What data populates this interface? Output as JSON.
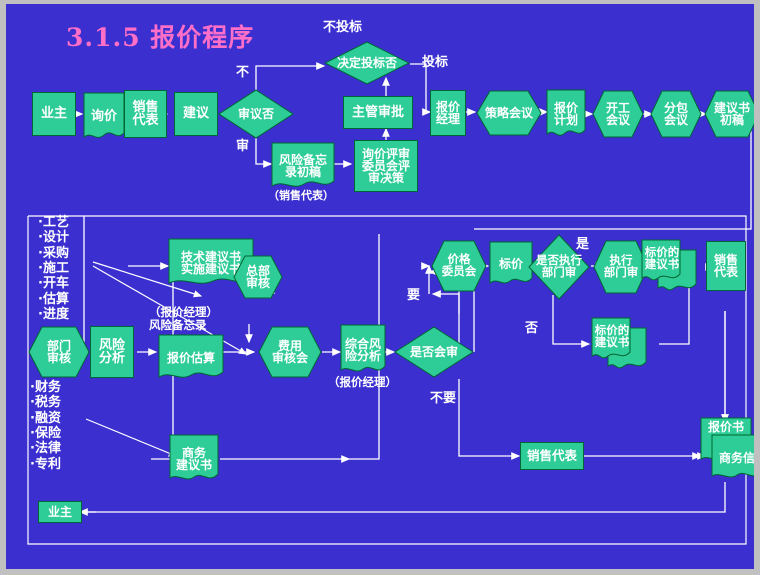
{
  "slide": {
    "title": "3.1.5  报价程序",
    "title_color": "#ff6ec7",
    "background_color": "#3b2fd0",
    "node_fill": "#2ecc96",
    "line_color": "#ffffff",
    "text_color": "#ffffff"
  },
  "row1": {
    "n_owner": "业主",
    "n_inquiry": "询价",
    "n_salesrep": "销售\n代表",
    "n_suggest": "建议",
    "n_review_q": "审议否",
    "lbl_no_review": "不",
    "lbl_review": "审",
    "n_risk_memo": "风险备忘\n录初稿",
    "cap_risk_memo": "（销售代表）",
    "n_inquiry_committee": "询价评审\n委员会评\n审决策",
    "n_supervisor": "主管审批",
    "n_decide_bid": "决定投标否",
    "lbl_no_bid": "不投标",
    "lbl_bid": "投标",
    "n_quote_mgr": "报价\n经理",
    "n_strategy_mtg": "策略会议",
    "n_quote_plan": "报价\n计划",
    "n_kickoff_mtg": "开工\n会议",
    "n_subcontract_mtg": "分包\n会议",
    "n_proposal_draft": "建议书\n初稿"
  },
  "row2": {
    "list_top": "·工艺\n·设计\n·采购\n·施工\n·开车\n·估算\n·进度",
    "list_bottom": "·财务\n·税务\n·融资\n·保险\n·法律\n·专利",
    "n_dept_review": "部门\n审核",
    "n_risk_analysis": "风险\n分析",
    "n_tech_proposal": "技术建议书\n实施建议书",
    "cap_quote_mgr": "（报价经理）\n风险备忘录",
    "n_quote_estimate": "报价估算",
    "n_hq_review": "总部\n审核",
    "n_cost_review_mtg": "费用\n审核会",
    "n_comprehensive_risk": "综合风\n险分析",
    "cap_comprehensive": "（报价经理）",
    "n_joint_review_q": "是否会审",
    "lbl_yes_need": "要",
    "lbl_no_need": "不要",
    "n_price_committee": "价格\n委员会",
    "n_bid_price": "标价",
    "n_exec_dept_q": "是否执行\n部门审",
    "lbl_yes": "是",
    "lbl_no": "否",
    "n_exec_dept": "执行\n部门审",
    "n_priced_proposal_top": "标价的\n建议书",
    "n_priced_proposal_mid": "标价的\n建议书",
    "n_salesrep_right": "销售\n代表",
    "n_business_proposal": "商务\n建议书",
    "n_salesrep_bottom": "销售代表",
    "n_quotation_doc": "报价书",
    "n_business_letter": "商务信",
    "n_owner_bottom": "业主"
  }
}
